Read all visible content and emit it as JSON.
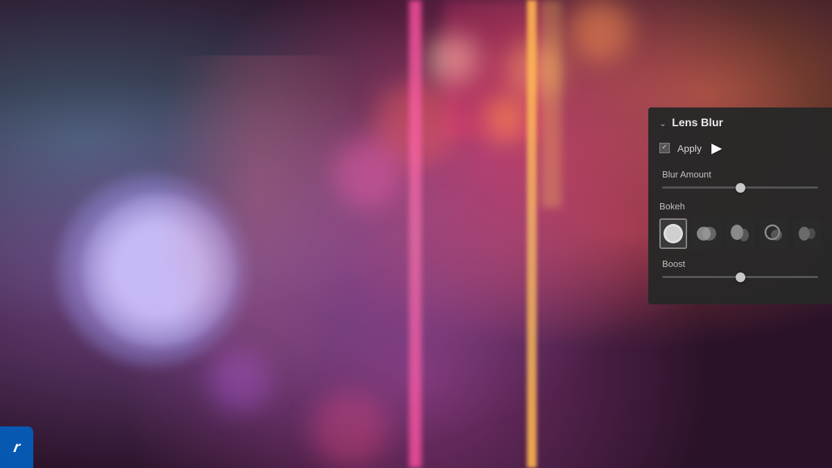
{
  "background": {
    "color": "#2a1228"
  },
  "panel": {
    "title": "Lens Blur",
    "collapse_icon": "chevron-down",
    "apply_label": "Apply",
    "apply_checked": true,
    "blur_amount_label": "Blur Amount",
    "blur_amount_value": 50,
    "bokeh_label": "Bokeh",
    "boost_label": "Boost",
    "boost_value": 50,
    "bokeh_options": [
      {
        "id": "circle",
        "label": "Circle bokeh",
        "selected": true
      },
      {
        "id": "bubble",
        "label": "Bubble bokeh",
        "selected": false
      },
      {
        "id": "cat-eye",
        "label": "Cat-eye bokeh",
        "selected": false
      },
      {
        "id": "swirl",
        "label": "Swirl bokeh",
        "selected": false
      },
      {
        "id": "blade",
        "label": "Blade bokeh",
        "selected": false
      }
    ]
  },
  "watermark": {
    "text": "r"
  }
}
